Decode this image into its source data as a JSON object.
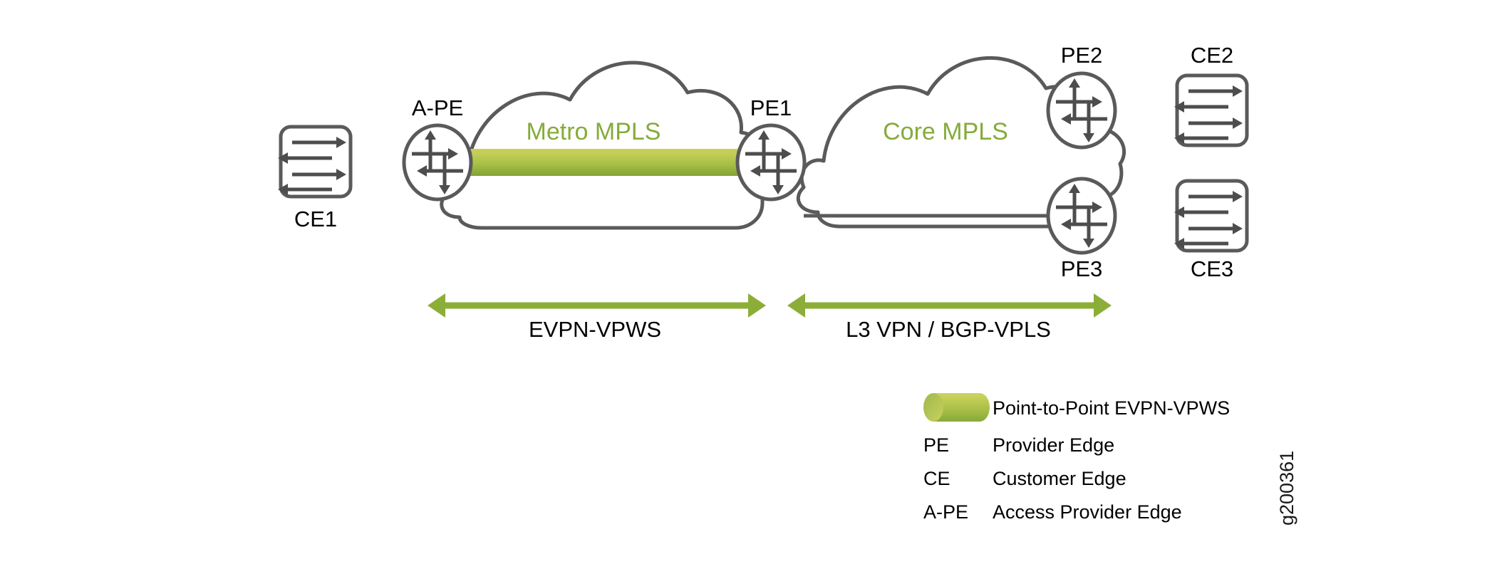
{
  "figure": {
    "id_label": "g200361",
    "background_color": "#ffffff",
    "line_color": "#5a5a5a",
    "link_color": "#8b8b8b",
    "green_accent": "#86ab3b",
    "pipe_light": "#c3ce55",
    "pipe_dark": "#84a638",
    "arrow_green": "#8cae38"
  },
  "clouds": [
    {
      "name": "metro-mpls-cloud",
      "label": "Metro MPLS"
    },
    {
      "name": "core-mpls-cloud",
      "label": "Core MPLS"
    }
  ],
  "nodes": [
    {
      "name": "ce1",
      "label": "CE1",
      "type": "switch",
      "label_position": "below"
    },
    {
      "name": "a-pe",
      "label": "A-PE",
      "type": "router",
      "label_position": "above"
    },
    {
      "name": "pe1",
      "label": "PE1",
      "type": "router",
      "label_position": "above"
    },
    {
      "name": "pe2",
      "label": "PE2",
      "type": "router",
      "label_position": "above"
    },
    {
      "name": "pe3",
      "label": "PE3",
      "type": "router",
      "label_position": "below"
    },
    {
      "name": "ce2",
      "label": "CE2",
      "type": "switch",
      "label_position": "above"
    },
    {
      "name": "ce3",
      "label": "CE3",
      "type": "switch",
      "label_position": "below"
    }
  ],
  "spans": [
    {
      "name": "evpn-vpws-span",
      "label": "EVPN-VPWS"
    },
    {
      "name": "l3vpn-bgpvpls-span",
      "label": "L3 VPN / BGP-VPLS"
    }
  ],
  "legend": {
    "items": [
      {
        "key": "",
        "desc": "Point-to-Point EVPN-VPWS",
        "swatch": "green-pipe"
      },
      {
        "key": "PE",
        "desc": "Provider Edge",
        "swatch": ""
      },
      {
        "key": "CE",
        "desc": "Customer Edge",
        "swatch": ""
      },
      {
        "key": "A-PE",
        "desc": "Access Provider Edge",
        "swatch": ""
      }
    ]
  }
}
